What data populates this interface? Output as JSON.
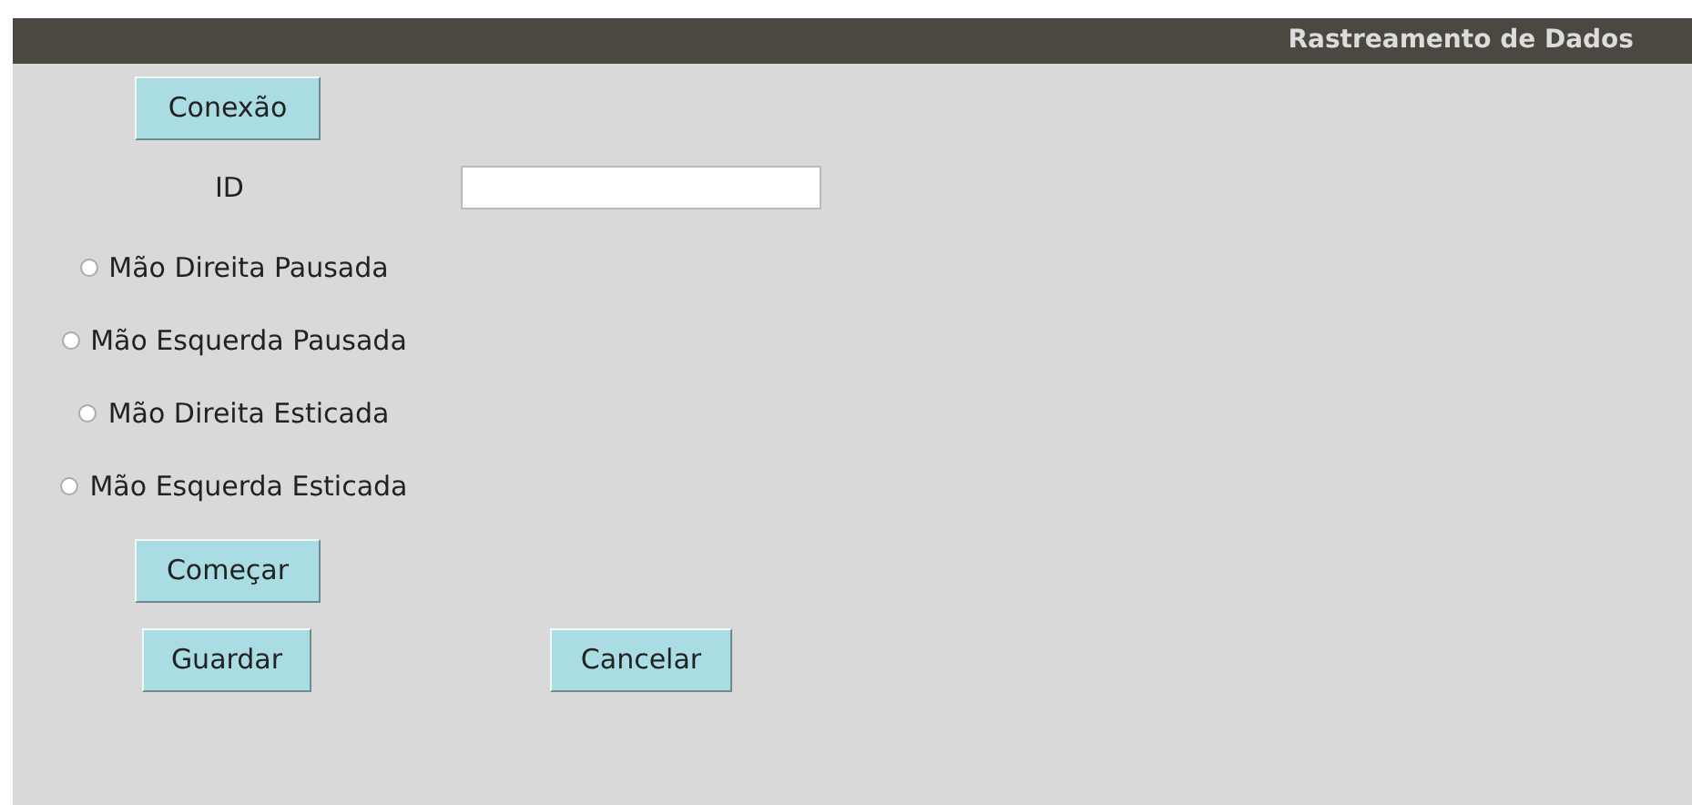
{
  "window": {
    "title": "Rastreamento de Dados"
  },
  "connect_button": "Conexão",
  "id_field": {
    "label": "ID"
  },
  "options": [
    {
      "label": "Mão Direita Pausada",
      "selected": false
    },
    {
      "label": "Mão Esquerda Pausada",
      "selected": false
    },
    {
      "label": "Mão Direita Esticada",
      "selected": false
    },
    {
      "label": "Mão Esquerda Esticada",
      "selected": false
    }
  ],
  "start_button": "Começar",
  "save_button": "Guardar",
  "cancel_button": "Cancelar"
}
